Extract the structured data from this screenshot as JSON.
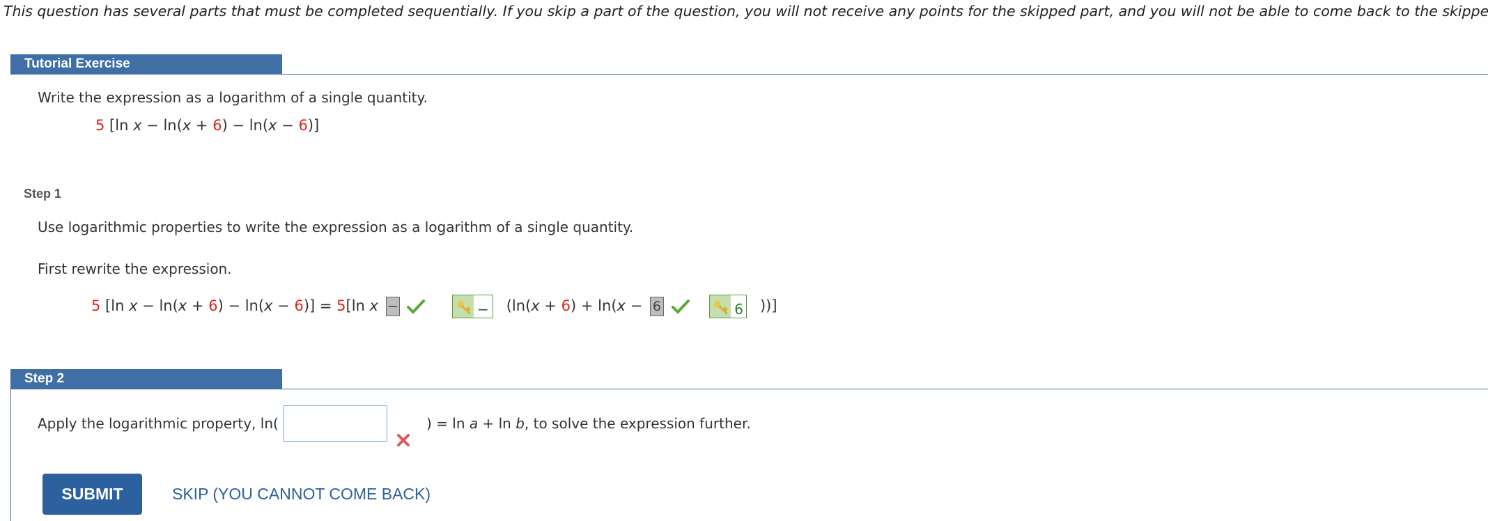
{
  "intro": "This question has several parts that must be completed sequentially. If you skip a part of the question, you will not receive any points for the skipped part, and you will not be able to come back to the skipped part.",
  "tutorial": {
    "header": "Tutorial Exercise",
    "instruction": "Write the expression as a logarithm of a single quantity.",
    "expr": {
      "coef": "5",
      "p1": " [ln ",
      "x": "x",
      "p2": " − ln(",
      "x2": "x",
      "p3": " + ",
      "n1": "6",
      "p4": ") − ln(",
      "x3": "x",
      "p5": " − ",
      "n2": "6",
      "p6": ")]"
    }
  },
  "step1": {
    "label": "Step 1",
    "instruction": "Use logarithmic properties to write the expression as a logarithm of a single quantity.",
    "first": "First rewrite the expression.",
    "lhs": {
      "coef": "5",
      "p1": " [ln ",
      "x": "x",
      "p2": " − ln(",
      "x2": "x",
      "p3": " + ",
      "n1": "6",
      "p4": ") − ln(",
      "x3": "x",
      "p5": " − ",
      "n2": "6",
      "p6": ")]"
    },
    "eq": " = ",
    "rhs_coef": "5",
    "rhs_start": "[ln ",
    "rhs_x": "x",
    "box1_value": "−",
    "key1_value": "−",
    "mid_a": "(ln(",
    "mid_x": "x",
    "mid_b": " + ",
    "mid_n": "6",
    "mid_c": ") + ln(",
    "mid_x2": "x",
    "mid_d": " − ",
    "box2_value": "6",
    "key2_value": "6",
    "end": "))]"
  },
  "step2": {
    "header": "Step 2",
    "apply": "Apply the logarithmic property,  ln(",
    "input_value": "",
    "after_a": ") = ln ",
    "a": "a",
    "plus": " + ln ",
    "b": "b",
    "after_b": ",  to solve the expression further."
  },
  "actions": {
    "submit": "SUBMIT",
    "skip": "SKIP (YOU CANNOT COME BACK)"
  },
  "colors": {
    "header_blue": "#3f6fa5",
    "red": "#d8281c",
    "green": "#2d7a2d",
    "button_blue": "#2c609f"
  }
}
